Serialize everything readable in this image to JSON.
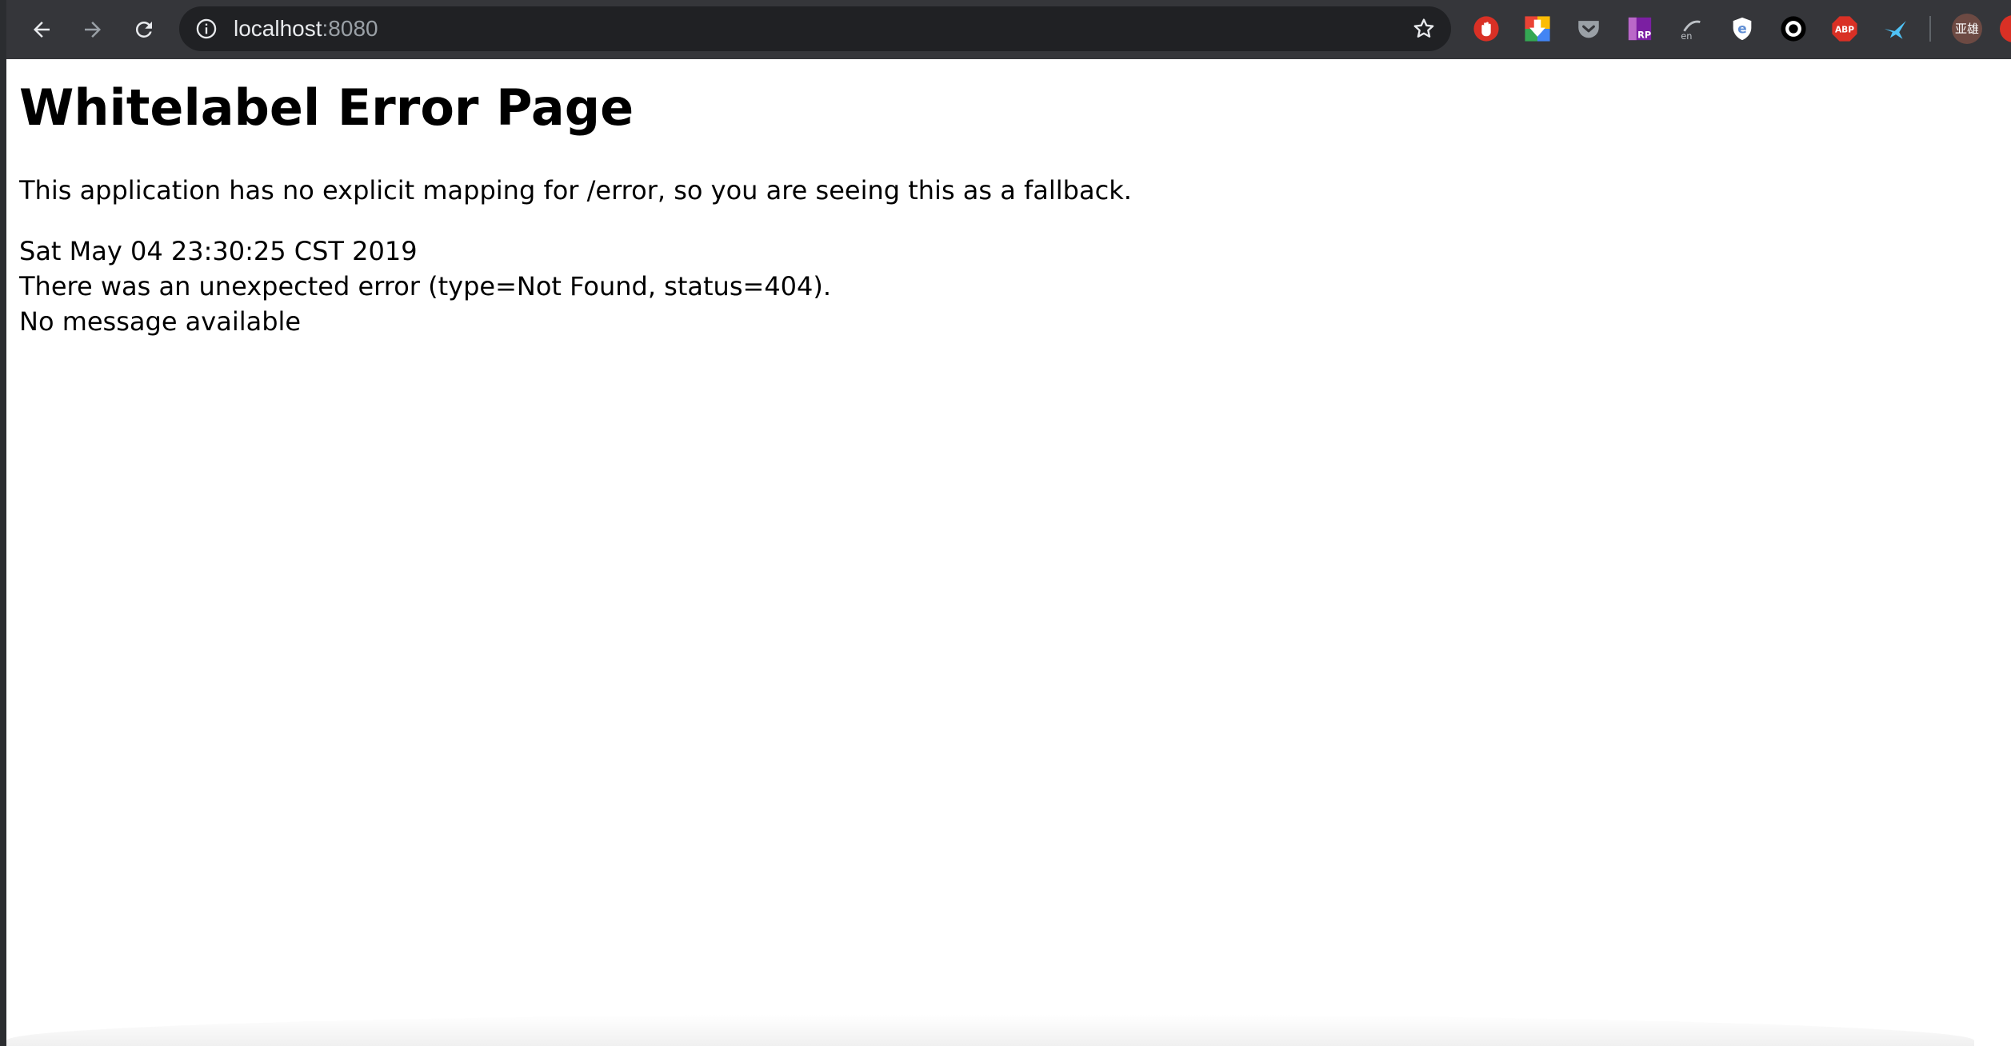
{
  "browser": {
    "url_host": "localhost",
    "url_port": ":8080",
    "nav": {
      "back_icon": "arrow-left-icon",
      "forward_icon": "arrow-right-icon",
      "reload_icon": "reload-icon"
    },
    "extensions": [
      {
        "name": "hand-stop-extension-icon",
        "color": "#d93025"
      },
      {
        "name": "download-extension-icon",
        "color": "#34a853"
      },
      {
        "name": "pocket-extension-icon",
        "color": "#9aa0a6"
      },
      {
        "name": "rp-extension-icon",
        "label": "RP",
        "color": "#9c27b0"
      },
      {
        "name": "en-translate-extension-icon",
        "label": "en",
        "color": "#9aa0a6"
      },
      {
        "name": "e-shield-extension-icon",
        "label": "e",
        "color": "#5f8dd3"
      },
      {
        "name": "ring-extension-icon",
        "color": "#000000"
      },
      {
        "name": "adblock-plus-extension-icon",
        "label": "ABP",
        "color": "#d93025"
      },
      {
        "name": "bird-extension-icon",
        "color": "#4fc3f7"
      }
    ],
    "profile_label": "亚雄"
  },
  "page": {
    "title": "Whitelabel Error Page",
    "intro": "This application has no explicit mapping for /error, so you are seeing this as a fallback.",
    "timestamp": "Sat May 04 23:30:25 CST 2019",
    "error_line": "There was an unexpected error (type=Not Found, status=404).",
    "message": "No message available"
  }
}
